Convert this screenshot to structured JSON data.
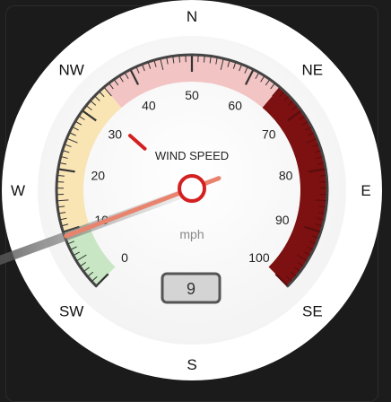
{
  "widget": {
    "title": "WIND SPEED",
    "unit": "mph",
    "value": 9,
    "value_display": "9",
    "min": 0,
    "max": 100,
    "wind_direction_deg": 250,
    "peak_value": 32
  },
  "compass": {
    "labels": [
      {
        "text": "N",
        "angle": 0
      },
      {
        "text": "NE",
        "angle": 45
      },
      {
        "text": "E",
        "angle": 90
      },
      {
        "text": "SE",
        "angle": 135
      },
      {
        "text": "S",
        "angle": 180
      },
      {
        "text": "SW",
        "angle": 225
      },
      {
        "text": "W",
        "angle": 270
      },
      {
        "text": "NW",
        "angle": 315
      }
    ]
  },
  "scale": {
    "labels": [
      "0",
      "10",
      "20",
      "30",
      "40",
      "50",
      "60",
      "70",
      "80",
      "90",
      "100"
    ],
    "bands": [
      {
        "from": 0,
        "to": 10,
        "color": "#c8e6c4"
      },
      {
        "from": 10,
        "to": 35,
        "color": "#f9e4b4"
      },
      {
        "from": 35,
        "to": 65,
        "color": "#f3c4c4"
      },
      {
        "from": 65,
        "to": 100,
        "color": "#7d1010"
      }
    ]
  },
  "colors": {
    "face": "#fbfbfb",
    "bezel": "#ffffff",
    "text": "#111111",
    "needle": "#e8836e",
    "peak": "#d42020",
    "wind_arrow": "#4a4a4a"
  }
}
